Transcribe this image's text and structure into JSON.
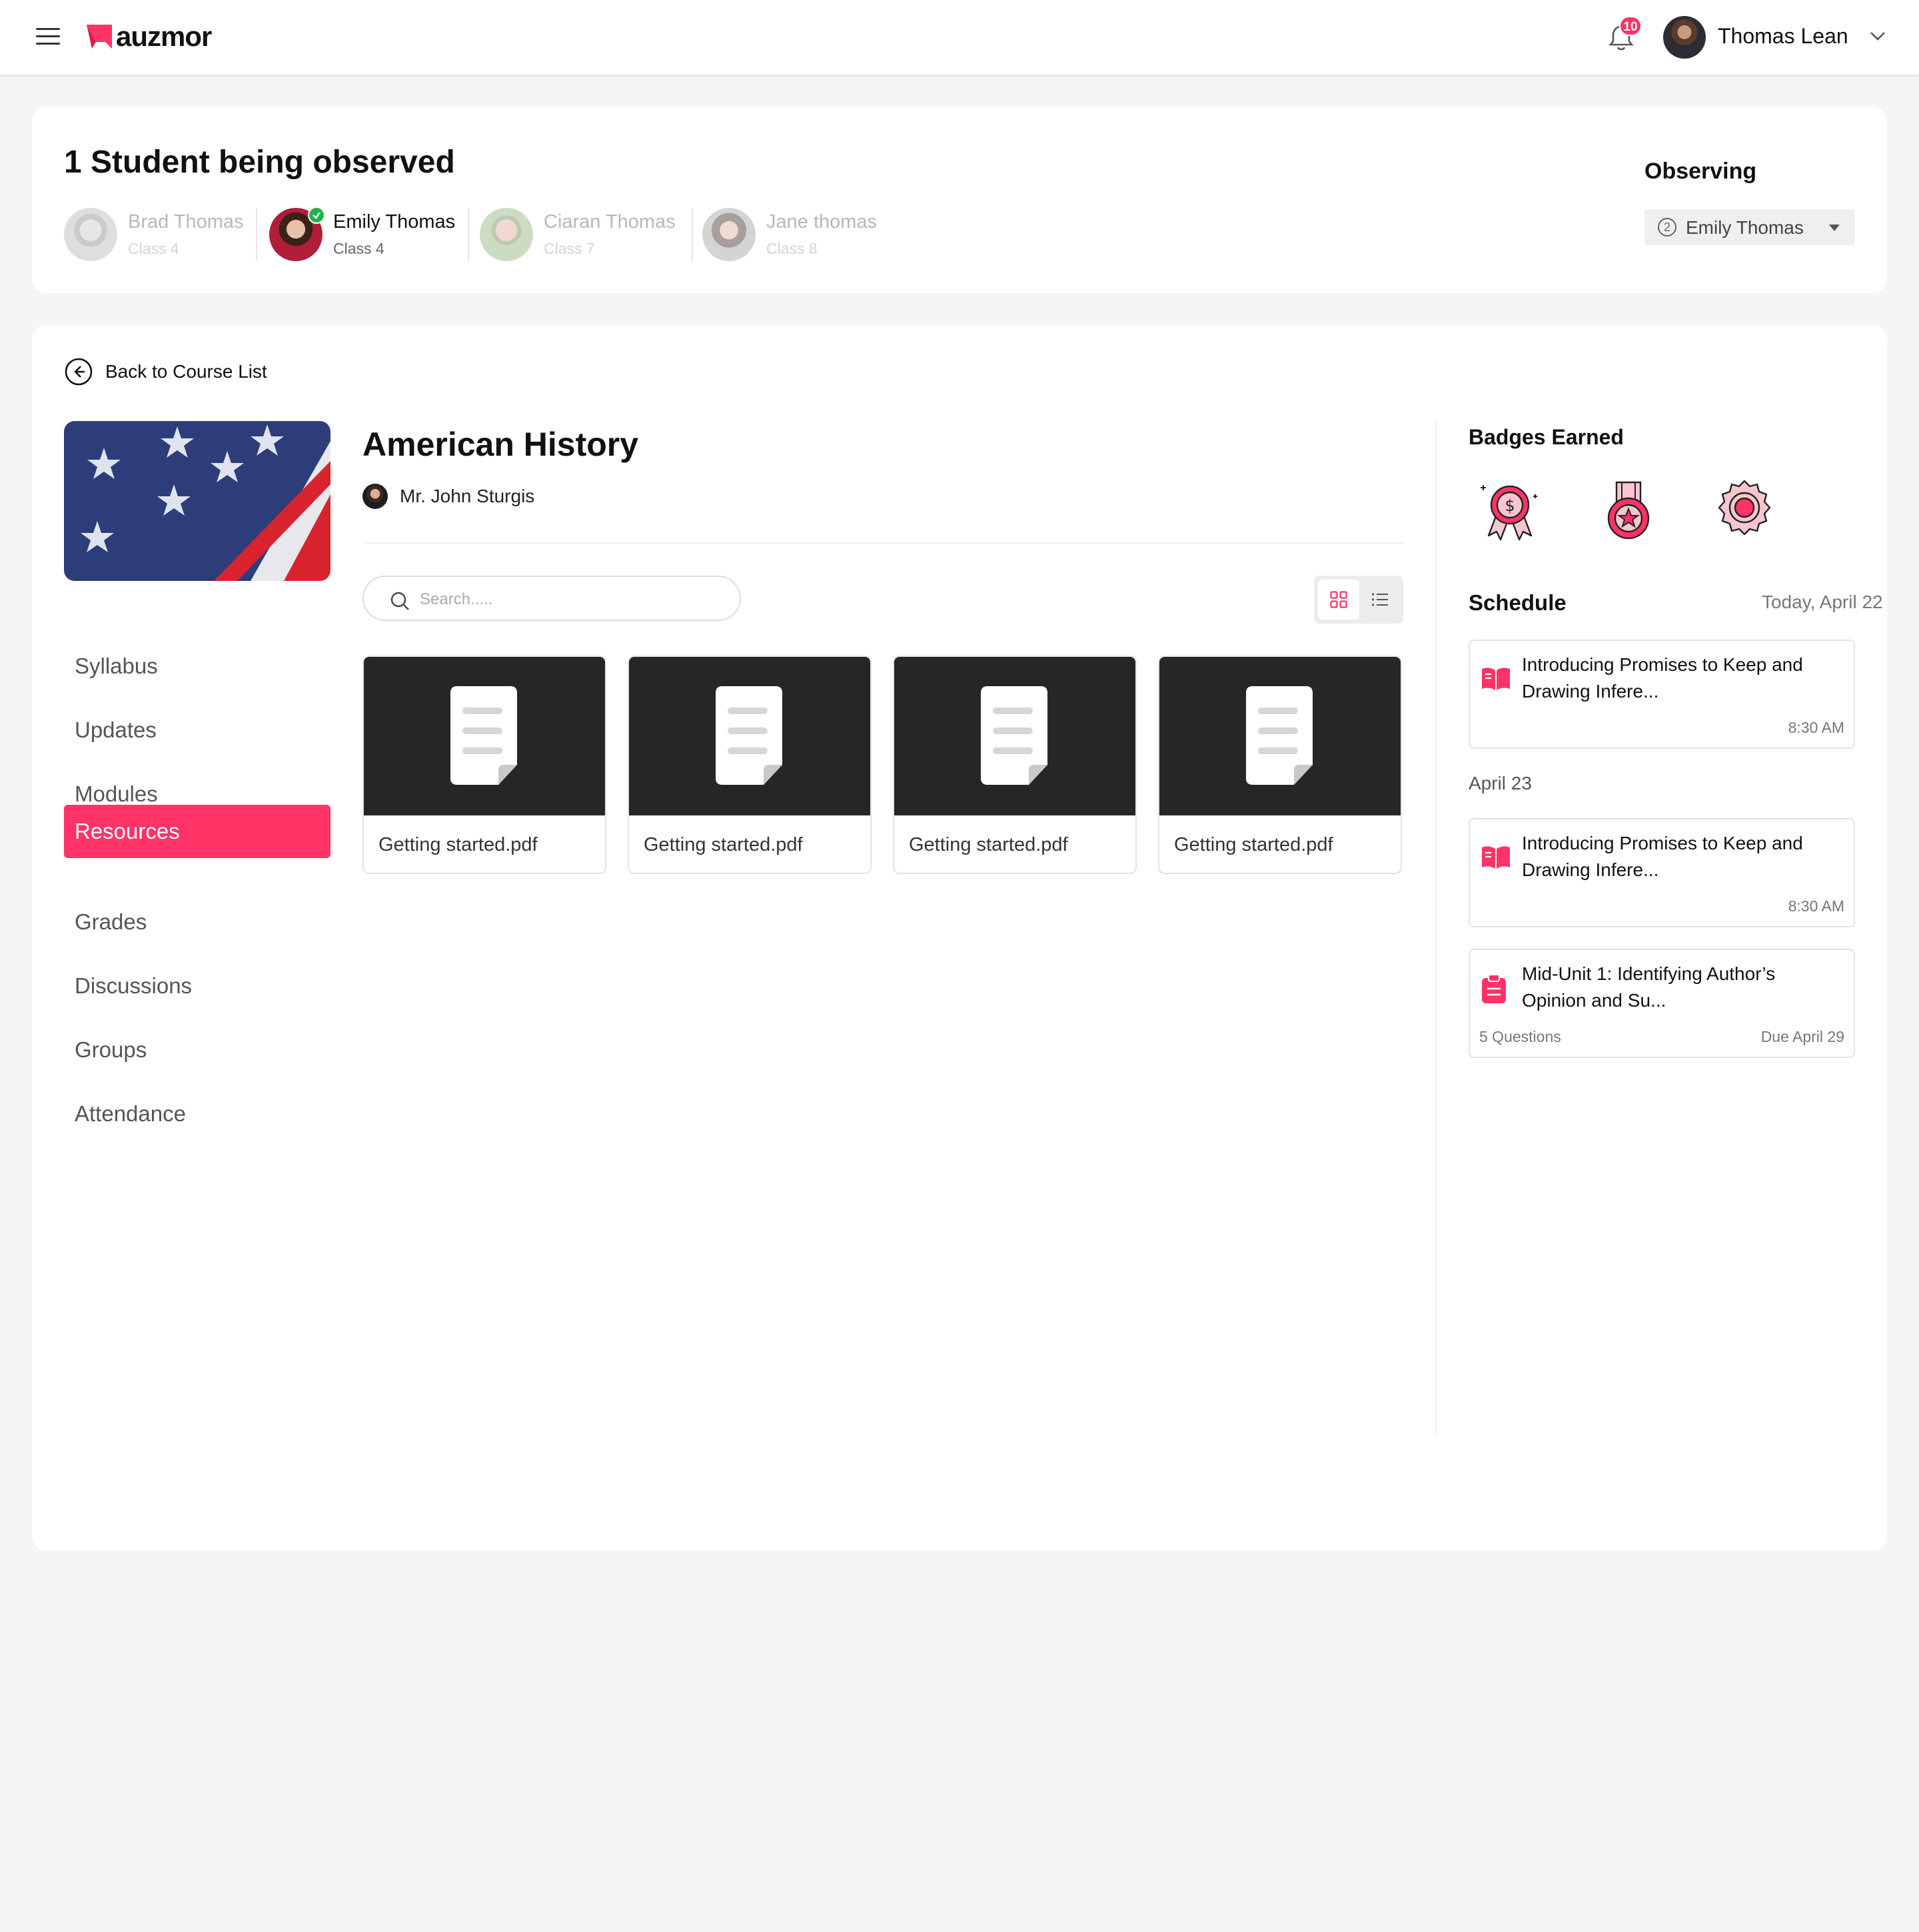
{
  "header": {
    "logo_text": "auzmor",
    "notification_count": "10",
    "user_name": "Thomas Lean"
  },
  "observation": {
    "title": "1 Student being observed",
    "students": [
      {
        "name": "Brad Thomas",
        "class": "Class 4"
      },
      {
        "name": "Emily Thomas",
        "class": "Class 4"
      },
      {
        "name": "Ciaran Thomas",
        "class": "Class 7"
      },
      {
        "name": "Jane thomas",
        "class": "Class 8"
      }
    ],
    "observing_label": "Observing",
    "selected_number": "2",
    "selected_student": "Emily Thomas"
  },
  "course": {
    "back_label": "Back to Course List",
    "title": "American History",
    "teacher": "Mr. John Sturgis",
    "nav": [
      "Syllabus",
      "Updates",
      "Modules",
      "Resources",
      "Grades",
      "Discussions",
      "Groups",
      "Attendance"
    ],
    "active_nav": "Resources",
    "search_placeholder": "Search.....",
    "files": [
      "Getting started.pdf",
      "Getting started.pdf",
      "Getting started.pdf",
      "Getting started.pdf"
    ]
  },
  "sidebar": {
    "badges_title": "Badges Earned",
    "badges": [
      "money-badge-icon",
      "star-medal-icon",
      "rosette-badge-icon"
    ],
    "schedule_title": "Schedule",
    "today_label": "Today, April 22",
    "today_events": [
      {
        "title": "Introducing Promises to Keep and Drawing Infere...",
        "time": "8:30 AM",
        "icon": "book-icon"
      }
    ],
    "next_day_label": "April 23",
    "next_day_events": [
      {
        "title": "Introducing Promises to Keep and Drawing Infere...",
        "time": "8:30 AM",
        "icon": "book-icon"
      },
      {
        "title": "Mid-Unit 1: Identifying Author’s Opinion and Su...",
        "questions": "5 Questions",
        "due": "Due April 29",
        "icon": "clipboard-icon"
      }
    ]
  },
  "colors": {
    "accent": "#ff3366",
    "background": "#f5f5f5",
    "file_thumb": "#262626"
  }
}
